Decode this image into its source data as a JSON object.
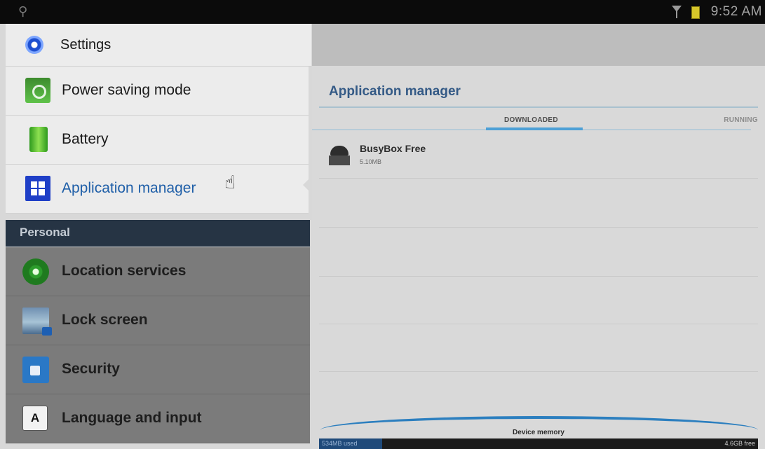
{
  "status_bar": {
    "time": "9:52 AM",
    "usb_icon": "usb-icon",
    "signal_icon": "signal-icon",
    "battery_icon": "battery-icon"
  },
  "left_pane": {
    "title": "Settings",
    "title_icon": "settings-gear-icon",
    "items": [
      {
        "label": "Power saving mode",
        "icon": "power-saving-icon"
      },
      {
        "label": "Battery",
        "icon": "battery-icon"
      },
      {
        "label": "Application manager",
        "icon": "apps-grid-icon",
        "active": true
      }
    ],
    "section_header": "Personal",
    "personal_items": [
      {
        "label": "Location services",
        "icon": "location-icon"
      },
      {
        "label": "Lock screen",
        "icon": "lock-screen-icon"
      },
      {
        "label": "Security",
        "icon": "security-lock-icon"
      },
      {
        "label": "Language and input",
        "icon": "language-icon",
        "glyph": "A"
      }
    ]
  },
  "right_pane": {
    "title": "Application manager",
    "tabs": [
      {
        "label": "DOWNLOADED",
        "selected": true
      },
      {
        "label": "RUNNING",
        "selected": false
      }
    ],
    "apps": [
      {
        "name": "BusyBox Free",
        "size": "5.10MB",
        "icon": "app-icon"
      }
    ],
    "memory": {
      "label": "Device memory",
      "used_text": "534MB used",
      "free_text": "4.6GB free"
    }
  },
  "colors": {
    "accent": "#1f5fa8",
    "section_bg": "#263444",
    "tab_indicator": "#4da0d6"
  }
}
